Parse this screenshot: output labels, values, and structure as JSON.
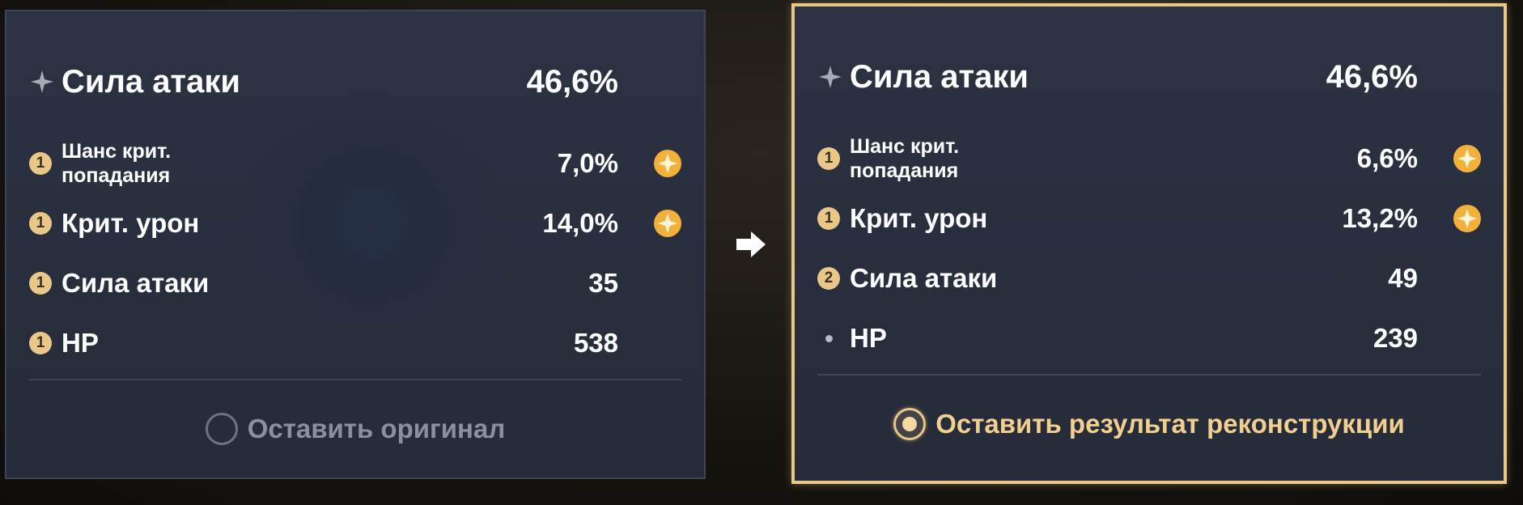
{
  "original": {
    "main_stat": {
      "label": "Сила атаки",
      "value": "46,6%"
    },
    "substats": [
      {
        "roll": "1",
        "label": "Шанс крит. попадания",
        "value": "7,0%",
        "icon": "crit-gem-icon"
      },
      {
        "roll": "1",
        "label": "Крит. урон",
        "value": "14,0%",
        "icon": "crit-gem-icon"
      },
      {
        "roll": "1",
        "label": "Сила атаки",
        "value": "35"
      },
      {
        "roll": "1",
        "label": "HP",
        "value": "538"
      }
    ],
    "option_label": "Оставить оригинал",
    "selected": false
  },
  "result": {
    "main_stat": {
      "label": "Сила атаки",
      "value": "46,6%"
    },
    "substats": [
      {
        "roll": "1",
        "label": "Шанс крит. попадания",
        "value": "6,6%",
        "icon": "crit-gem-icon"
      },
      {
        "roll": "1",
        "label": "Крит. урон",
        "value": "13,2%",
        "icon": "crit-gem-icon"
      },
      {
        "roll": "2",
        "label": "Сила атаки",
        "value": "49"
      },
      {
        "roll": "",
        "label": "HP",
        "value": "239"
      }
    ],
    "option_label": "Оставить результат реконструкции",
    "selected": true
  },
  "colors": {
    "accent": "#e8c789",
    "gem": "#f2b13a",
    "panel": "#2a3040"
  }
}
